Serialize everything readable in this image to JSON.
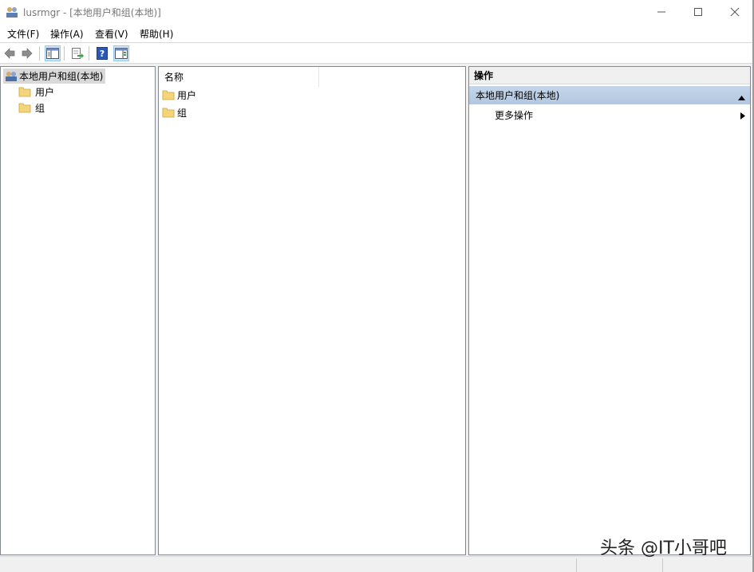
{
  "window": {
    "title": "lusrmgr - [本地用户和组(本地)]",
    "controls": {
      "minimize": "—",
      "maximize": "☐",
      "close": "✕"
    }
  },
  "menu": {
    "items": [
      "文件(F)",
      "操作(A)",
      "查看(V)",
      "帮助(H)"
    ]
  },
  "toolbar": {
    "buttons": [
      "back-icon",
      "forward-icon",
      "show-hide-console-tree-icon",
      "export-list-icon",
      "help-icon",
      "show-hide-action-pane-icon"
    ]
  },
  "tree": {
    "root": "本地用户和组(本地)",
    "children": [
      "用户",
      "组"
    ]
  },
  "list": {
    "column_header": "名称",
    "items": [
      "用户",
      "组"
    ]
  },
  "actions": {
    "header": "操作",
    "group": "本地用户和组(本地)",
    "more": "更多操作"
  },
  "watermark": "头条 @IT小哥吧",
  "colors": {
    "accent_header": "#b9cde4",
    "selection": "#d9d9d9",
    "folder": "#f3d57a"
  }
}
